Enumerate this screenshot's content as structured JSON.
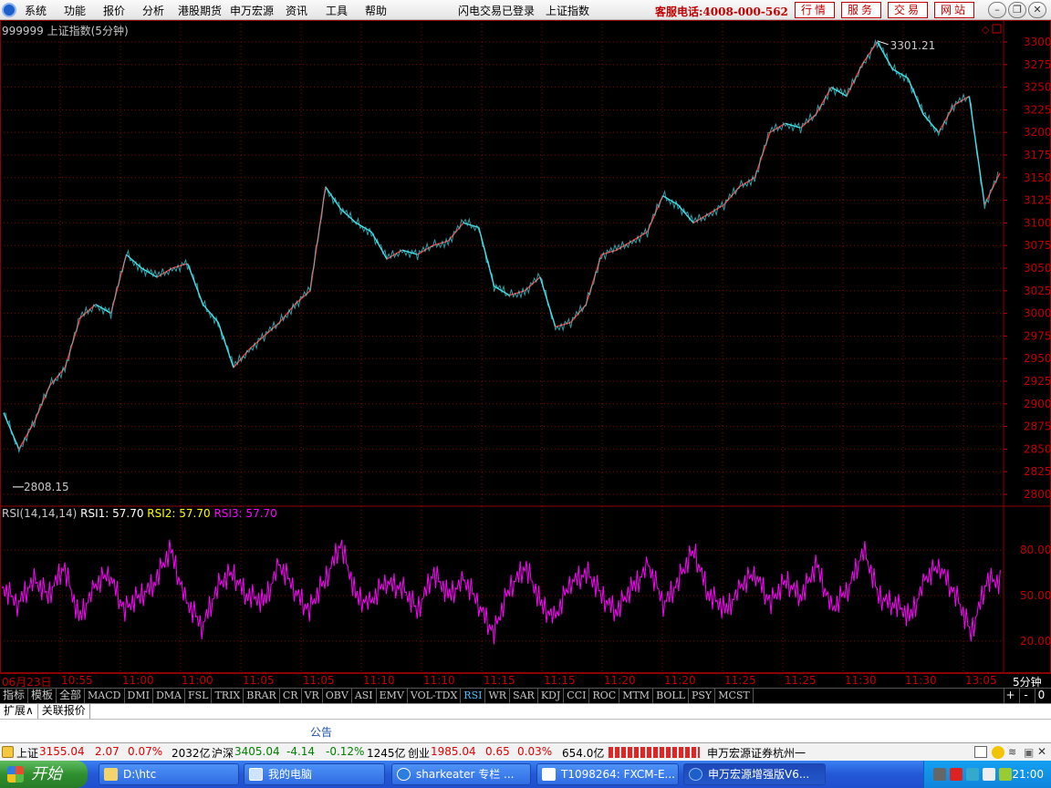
{
  "menu": {
    "items": [
      "系统",
      "功能",
      "报价",
      "分析",
      "港股期货",
      "申万宏源",
      "资讯",
      "工具",
      "帮助"
    ],
    "status": "闪电交易已登录",
    "index_name": "上证指数",
    "hotline": "客服电话:4008-000-562",
    "buttons": [
      "行情",
      "服务",
      "交易",
      "网站"
    ]
  },
  "chart": {
    "title": "999999 上证指数(5分钟)",
    "high_label": "3301.21",
    "low_label": "2808.15",
    "price_ticks": [
      "3300",
      "3275",
      "3250",
      "3225",
      "3200",
      "3175",
      "3150",
      "3125",
      "3100",
      "3075",
      "3050",
      "3025",
      "3000",
      "2975",
      "2950",
      "2925",
      "2900",
      "2875",
      "2850",
      "2825",
      "2800"
    ],
    "rsi_params": "RSI(14,14,14)",
    "rsi1": "RSI1: 57.70",
    "rsi2": "RSI2: 57.70",
    "rsi3": "RSI3: 57.70",
    "rsi_ticks": [
      "80.00",
      "50.00",
      "20.00"
    ],
    "colors": {
      "up": "#ff3030",
      "down": "#40e0e8",
      "rsi": "#ff00ff",
      "grid": "#8b0000",
      "rsi1": "#ffffff",
      "rsi2": "#ffff00",
      "rsi3": "#ff00ff"
    }
  },
  "chart_data": {
    "type": "line",
    "title": "999999 上证指数(5分钟)",
    "ylim": [
      2800,
      3300
    ],
    "x": [
      "06月23日",
      "10:55",
      "11:00",
      "11:05",
      "11:10",
      "11:15",
      "11:20",
      "11:25",
      "11:30",
      "13:05"
    ],
    "series": [
      {
        "name": "上证指数",
        "values": [
          2890,
          2850,
          2880,
          2920,
          2940,
          2995,
          3010,
          3000,
          3065,
          3050,
          3040,
          3050,
          3055,
          3010,
          2990,
          2940,
          2960,
          2975,
          2990,
          3010,
          3025,
          3140,
          3115,
          3100,
          3090,
          3060,
          3070,
          3065,
          3075,
          3080,
          3100,
          3095,
          3030,
          3020,
          3025,
          3040,
          2985,
          2990,
          3010,
          3065,
          3070,
          3080,
          3090,
          3130,
          3120,
          3100,
          3110,
          3120,
          3140,
          3150,
          3200,
          3210,
          3205,
          3220,
          3250,
          3240,
          3275,
          3300,
          3270,
          3260,
          3220,
          3200,
          3230,
          3240,
          3120,
          3155
        ]
      }
    ],
    "rsi": {
      "name": "RSI1",
      "values": [
        55,
        45,
        60,
        50,
        70,
        35,
        55,
        65,
        40,
        50,
        60,
        80,
        45,
        30,
        55,
        65,
        50,
        45,
        70,
        55,
        40,
        60,
        85,
        50,
        45,
        60,
        55,
        40,
        65,
        50,
        60,
        45,
        25,
        55,
        70,
        45,
        35,
        60,
        65,
        50,
        40,
        55,
        70,
        45,
        60,
        80,
        50,
        40,
        55,
        65,
        45,
        60,
        50,
        70,
        40,
        55,
        80,
        50,
        45,
        35,
        60,
        70,
        50,
        25,
        60,
        57.7
      ]
    },
    "rsi_ylim": [
      0,
      100
    ]
  },
  "time_ticks": [
    "06月23日",
    "10:55",
    "11:00",
    "11:05",
    "11:05",
    "11:10",
    "11:10",
    "11:15",
    "11:15",
    "11:20",
    "11:20",
    "11:25",
    "11:25",
    "11:30",
    "11:30",
    "13:05"
  ],
  "period": "5分钟",
  "indicators": [
    "指标",
    "模板",
    "全部",
    "MACD",
    "DMI",
    "DMA",
    "FSL",
    "TRIX",
    "BRAR",
    "CR",
    "VR",
    "OBV",
    "ASI",
    "EMV",
    "VOL-TDX",
    "RSI",
    "WR",
    "SAR",
    "KDJ",
    "CCI",
    "ROC",
    "MTM",
    "BOLL",
    "PSY",
    "MCST"
  ],
  "indicator_controls": [
    "+",
    "-",
    "0"
  ],
  "expand_tabs": [
    "扩展∧",
    "关联报价"
  ],
  "notice": "公告",
  "status": {
    "sh_label": "上证",
    "sh_value": "3155.04",
    "sh_change": "2.07",
    "sh_pct": "0.07%",
    "sh_amount": "2032亿",
    "hs_label": "沪深",
    "hs_value": "3405.04",
    "hs_change": "-4.14",
    "hs_pct": "-0.12%",
    "hs_amount": "1245亿",
    "cy_label": "创业",
    "cy_value": "1985.04",
    "cy_change": "0.65",
    "cy_pct": "0.03%",
    "cy_amount": "654.0亿",
    "broker": "申万宏源证券杭州一"
  },
  "taskbar": {
    "start": "开始",
    "tasks": [
      "D:\\htc",
      "我的电脑",
      "sharkeater 专栏 ...",
      "T1098264: FXCM-E...",
      "申万宏源增强版V6..."
    ],
    "clock": "21:00"
  }
}
